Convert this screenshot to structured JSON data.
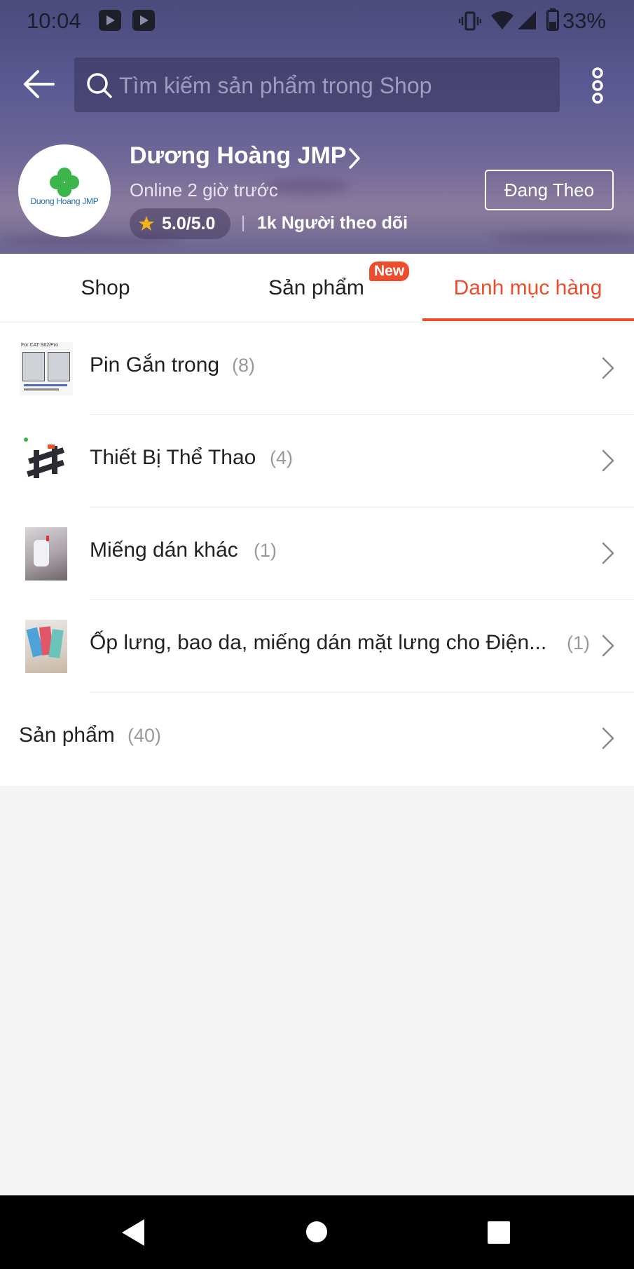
{
  "status_bar": {
    "time": "10:04",
    "battery": "33%"
  },
  "search": {
    "placeholder": "Tìm kiếm sản phẩm trong Shop"
  },
  "shop": {
    "logo_text": "Duong Hoang JMP",
    "name": "Dương Hoàng JMP",
    "online": "Online 2 giờ trước",
    "rating": "5.0/5.0",
    "followers": "1k Người theo dõi",
    "follow_button": "Đang Theo"
  },
  "tabs": [
    {
      "label": "Shop",
      "active": false
    },
    {
      "label": "Sản phẩm",
      "active": false,
      "badge": "New"
    },
    {
      "label": "Danh mục hàng",
      "active": true
    }
  ],
  "categories": [
    {
      "label": "Pin Gắn trong",
      "count": "(8)",
      "thumb_caption": "For CAT S62/Pro"
    },
    {
      "label": "Thiết Bị Thể Thao",
      "count": "(4)"
    },
    {
      "label": "Miếng dán khác",
      "count": "(1)"
    },
    {
      "label": "Ốp lưng, bao da, miếng dán mặt lưng cho Điện...",
      "count": "(1)"
    }
  ],
  "all_products": {
    "label": "Sản phẩm",
    "count": "(40)"
  },
  "colors": {
    "accent": "#ee4d2d",
    "header_bg": "#5b5a93",
    "nav_bar": "#000000"
  }
}
